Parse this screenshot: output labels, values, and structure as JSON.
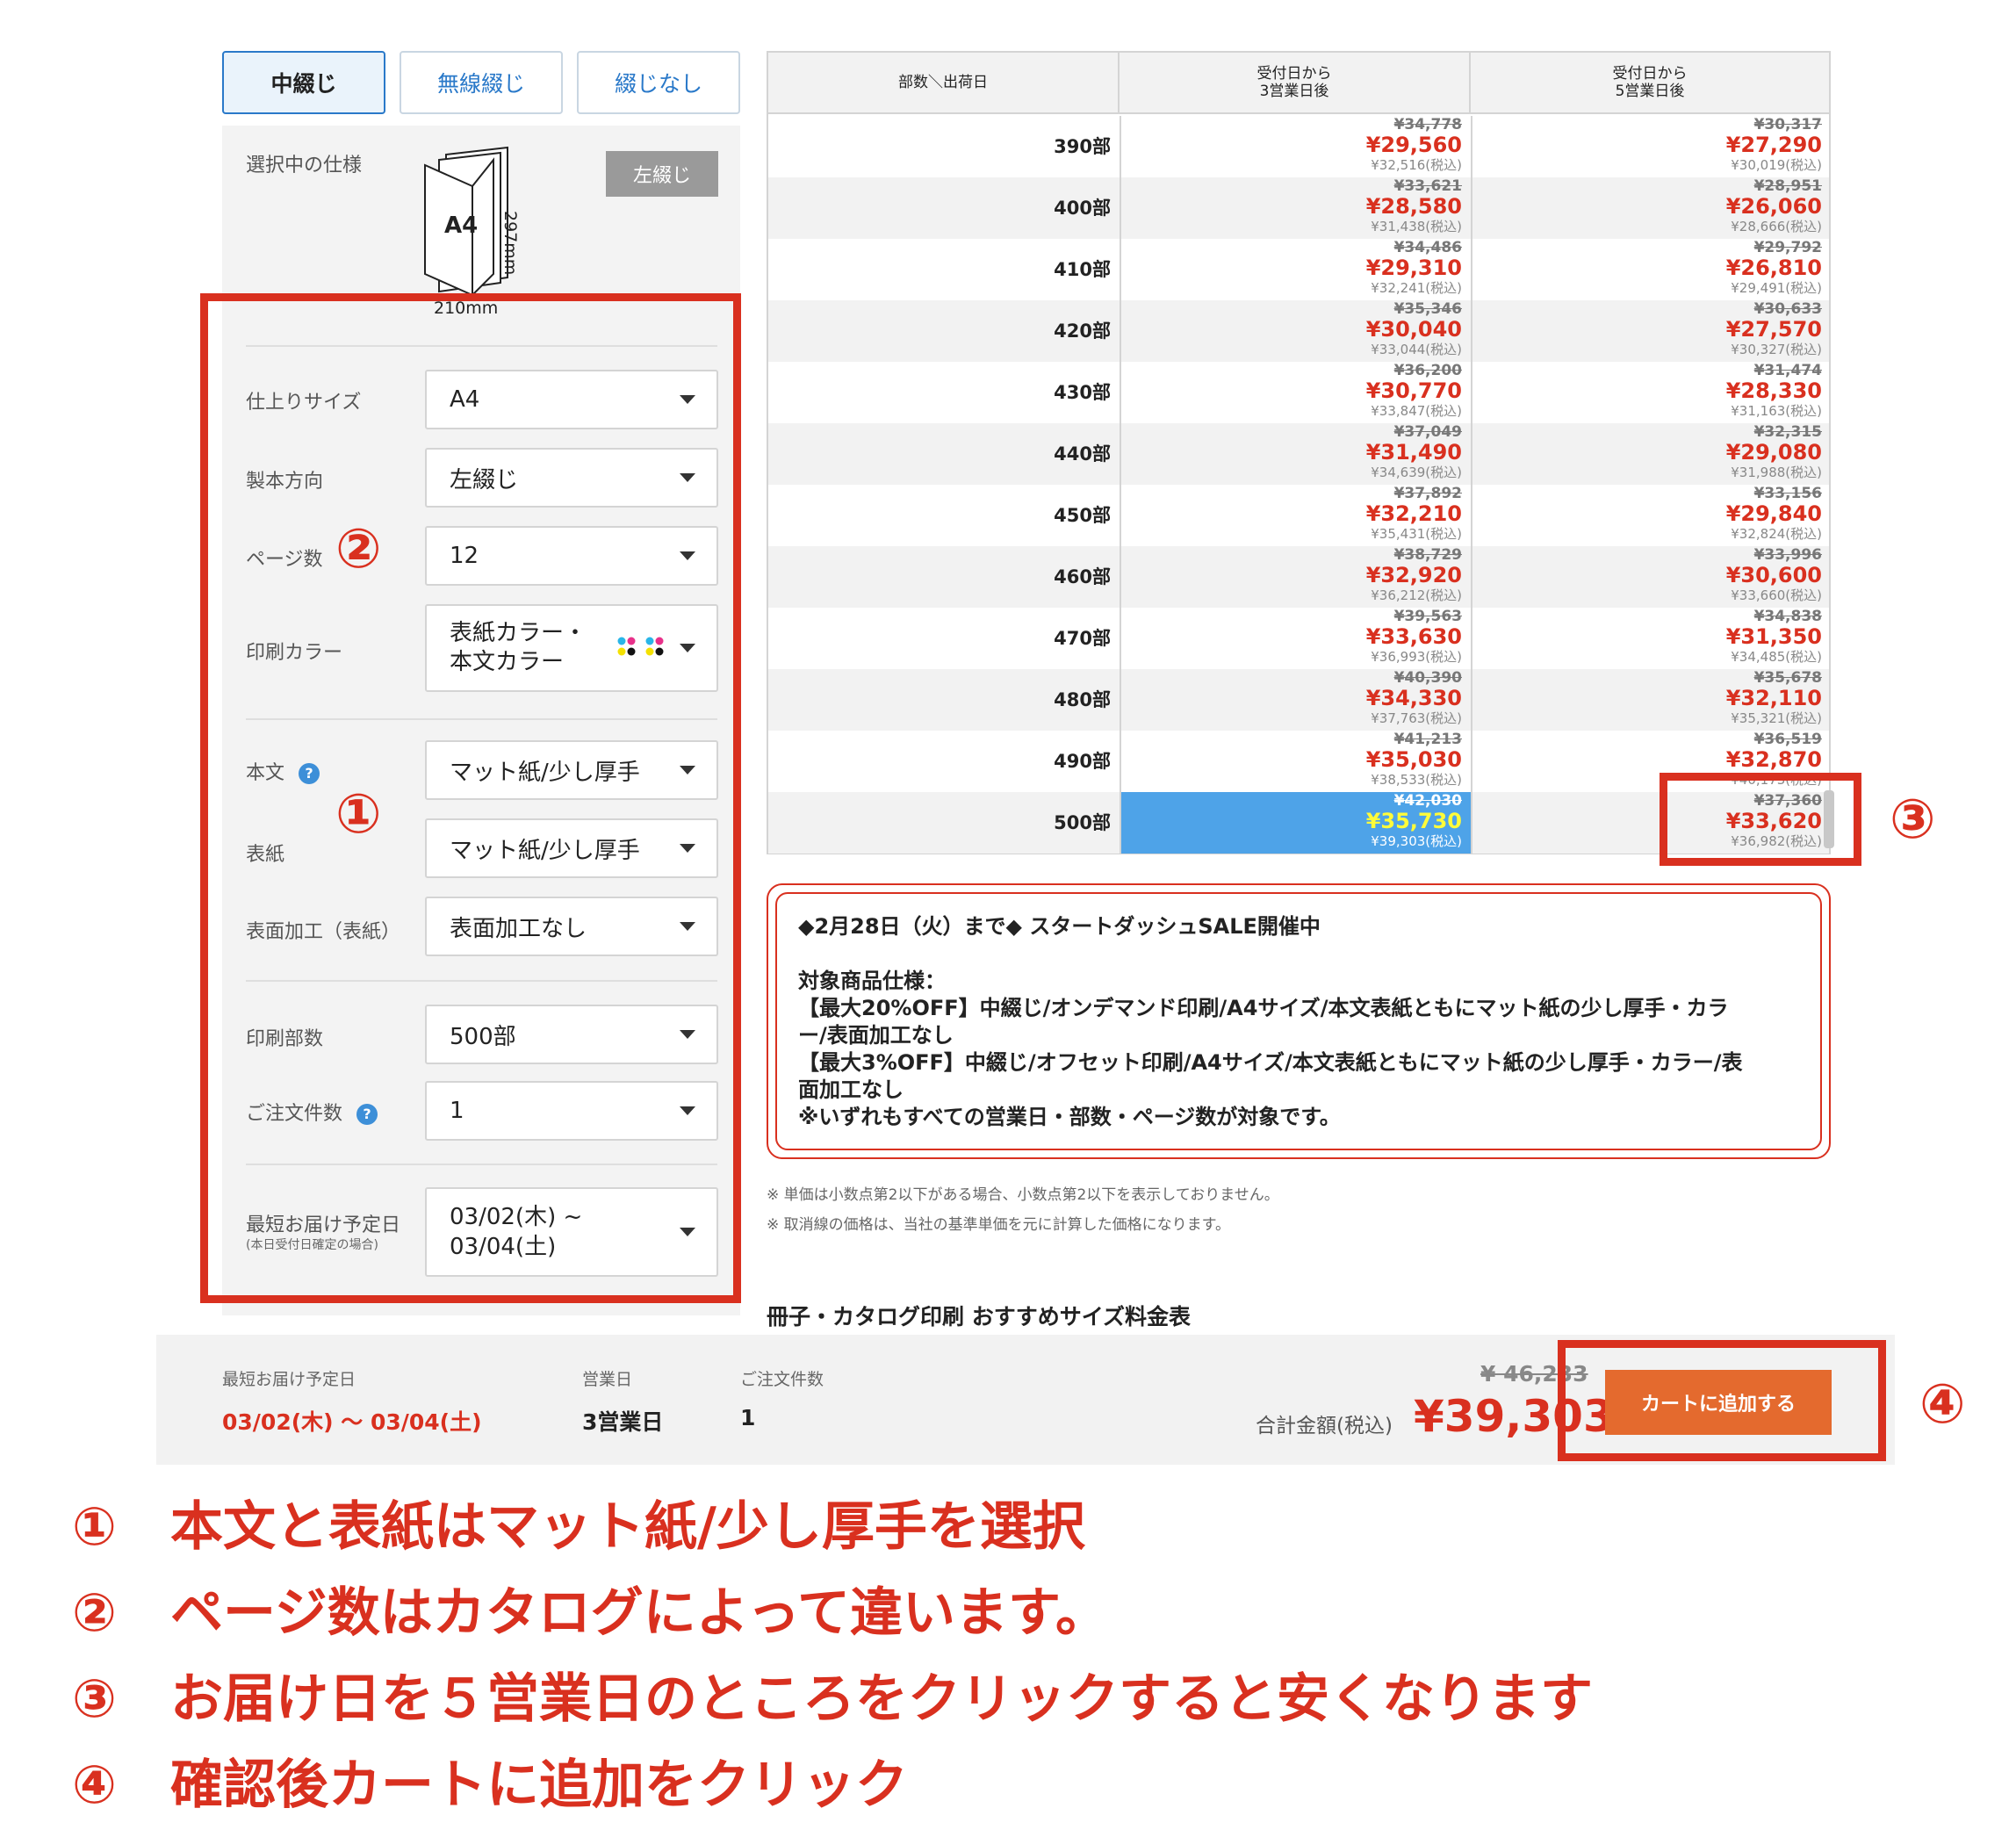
{
  "tabs": [
    "中綴じ",
    "無線綴じ",
    "綴じなし"
  ],
  "spec": {
    "heading": "選択中の仕様",
    "badge": "左綴じ",
    "size": "A4",
    "height": "297mm",
    "width": "210mm"
  },
  "fields": {
    "size": {
      "label": "仕上りサイズ",
      "value": "A4"
    },
    "direction": {
      "label": "製本方向",
      "value": "左綴じ"
    },
    "pages": {
      "label": "ページ数",
      "value": "12"
    },
    "color": {
      "label": "印刷カラー",
      "value1": "表紙カラー・",
      "value2": "本文カラー"
    },
    "body": {
      "label": "本文",
      "value": "マット紙/少し厚手"
    },
    "cover": {
      "label": "表紙",
      "value": "マット紙/少し厚手"
    },
    "finish": {
      "label": "表面加工（表紙）",
      "value": "表面加工なし"
    },
    "qty": {
      "label": "印刷部数",
      "value": "500部"
    },
    "orders": {
      "label": "ご注文件数",
      "value": "1"
    },
    "delivery": {
      "label": "最短お届け予定日",
      "sub": "(本日受付日確定の場合)",
      "value1": "03/02(木) ~",
      "value2": "03/04(土)"
    }
  },
  "help_icon": "?",
  "markers": [
    "①",
    "②",
    "③",
    "④"
  ],
  "table": {
    "header": {
      "corner": "部数＼出荷日",
      "col1_l1": "受付日から",
      "col1_l2": "3営業日後",
      "col2_l1": "受付日から",
      "col2_l2": "5営業日後"
    },
    "rows": [
      {
        "qty": "390部",
        "c1": [
          "¥34,778",
          "¥29,560",
          "¥32,516(税込)"
        ],
        "c2": [
          "¥30,317",
          "¥27,290",
          "¥30,019(税込)"
        ]
      },
      {
        "qty": "400部",
        "c1": [
          "¥33,621",
          "¥28,580",
          "¥31,438(税込)"
        ],
        "c2": [
          "¥28,951",
          "¥26,060",
          "¥28,666(税込)"
        ]
      },
      {
        "qty": "410部",
        "c1": [
          "¥34,486",
          "¥29,310",
          "¥32,241(税込)"
        ],
        "c2": [
          "¥29,792",
          "¥26,810",
          "¥29,491(税込)"
        ]
      },
      {
        "qty": "420部",
        "c1": [
          "¥35,346",
          "¥30,040",
          "¥33,044(税込)"
        ],
        "c2": [
          "¥30,633",
          "¥27,570",
          "¥30,327(税込)"
        ]
      },
      {
        "qty": "430部",
        "c1": [
          "¥36,200",
          "¥30,770",
          "¥33,847(税込)"
        ],
        "c2": [
          "¥31,474",
          "¥28,330",
          "¥31,163(税込)"
        ]
      },
      {
        "qty": "440部",
        "c1": [
          "¥37,049",
          "¥31,490",
          "¥34,639(税込)"
        ],
        "c2": [
          "¥32,315",
          "¥29,080",
          "¥31,988(税込)"
        ]
      },
      {
        "qty": "450部",
        "c1": [
          "¥37,892",
          "¥32,210",
          "¥35,431(税込)"
        ],
        "c2": [
          "¥33,156",
          "¥29,840",
          "¥32,824(税込)"
        ]
      },
      {
        "qty": "460部",
        "c1": [
          "¥38,729",
          "¥32,920",
          "¥36,212(税込)"
        ],
        "c2": [
          "¥33,996",
          "¥30,600",
          "¥33,660(税込)"
        ]
      },
      {
        "qty": "470部",
        "c1": [
          "¥39,563",
          "¥33,630",
          "¥36,993(税込)"
        ],
        "c2": [
          "¥34,838",
          "¥31,350",
          "¥34,485(税込)"
        ]
      },
      {
        "qty": "480部",
        "c1": [
          "¥40,390",
          "¥34,330",
          "¥37,763(税込)"
        ],
        "c2": [
          "¥35,678",
          "¥32,110",
          "¥35,321(税込)"
        ]
      },
      {
        "qty": "490部",
        "c1": [
          "¥41,213",
          "¥35,030",
          "¥38,533(税込)"
        ],
        "c2": [
          "¥36,519",
          "¥32,870",
          "¥40,173(税込)"
        ]
      },
      {
        "qty": "500部",
        "c1": [
          "¥42,030",
          "¥35,730",
          "¥39,303(税込)"
        ],
        "c2": [
          "¥37,360",
          "¥33,620",
          "¥36,982(税込)"
        ]
      }
    ]
  },
  "sale": {
    "line1": "◆2月28日（火）まで◆ スタートダッシュSALE開催中",
    "line2": "対象商品仕様：",
    "line3": "【最大20%OFF】中綴じ/オンデマンド印刷/A4サイズ/本文表紙ともにマット紙の少し厚手・カラ",
    "line4": "ー/表面加工なし",
    "line5": "【最大3%OFF】中綴じ/オフセット印刷/A4サイズ/本文表紙ともにマット紙の少し厚手・カラー/表",
    "line6": "面加工なし",
    "line7": "※いずれもすべての営業日・部数・ページ数が対象です。"
  },
  "notes": [
    "※ 単価は小数点第2以下がある場合、小数点第2以下を表示しておりません。",
    "※ 取消線の価格は、当社の基準単価を元に計算した価格になります。"
  ],
  "section_title": "冊子・カタログ印刷 おすすめサイズ料金表",
  "footer": {
    "delivery_label": "最短お届け予定日",
    "delivery_value": "03/02(木) 〜 03/04(土)",
    "days_label": "営業日",
    "days_value": "3営業日",
    "orders_label": "ご注文件数",
    "orders_value": "1",
    "old_total": "¥ 46,233",
    "total_label": "合計金額(税込)",
    "total": "¥39,303",
    "cart_button": "カートに追加する"
  },
  "instructions": [
    {
      "num": "①",
      "text": "本文と表紙はマット紙/少し厚手を選択"
    },
    {
      "num": "②",
      "text": "ページ数はカタログによって違います。"
    },
    {
      "num": "③",
      "text": "お届け日を５営業日のところをクリックすると安くなります"
    },
    {
      "num": "④",
      "text": "確認後カートに追加をクリック"
    }
  ],
  "colors": {
    "accent_red": "#d9301f",
    "selected_blue": "#4ea3e8",
    "cart_orange": "#e46a2e",
    "link_blue": "#2a79c9"
  }
}
